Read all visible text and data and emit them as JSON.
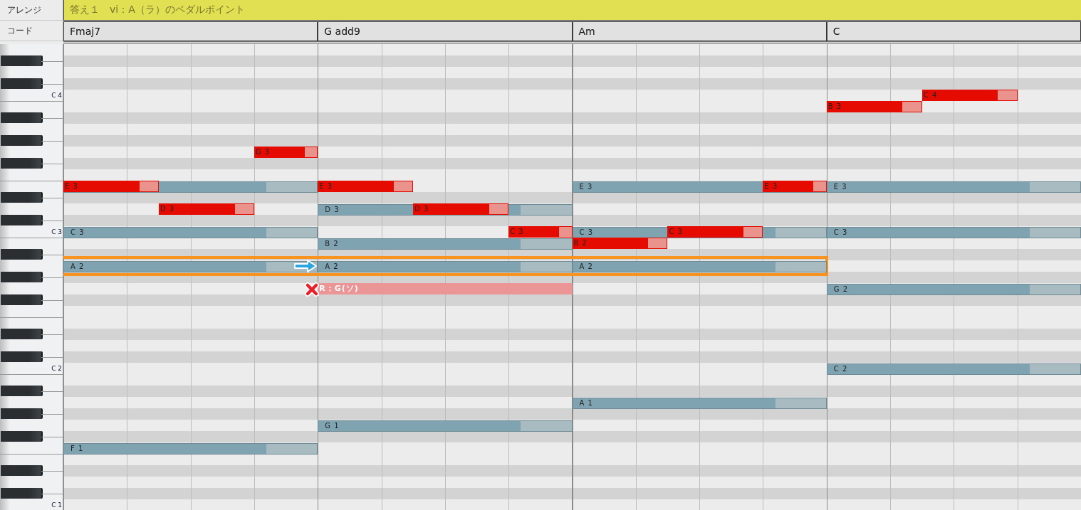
{
  "header": {
    "arrange_label": "アレンジ",
    "arrange_text": "答え１　vi：A（ラ）のペダルポイント",
    "chord_label": "コード",
    "chords": [
      "Fmaj7",
      "G add9",
      "Am",
      "C"
    ]
  },
  "keyboard_labels": [
    "C 4",
    "C 3",
    "C 2",
    "C 1"
  ],
  "notes": [
    {
      "kind": "chord"
    },
    {
      "kind": "chord",
      "label": "C 3"
    },
    {
      "kind": "chord",
      "label": "A 2"
    },
    {
      "kind": "chord",
      "label": "F 1"
    },
    {
      "kind": "chord",
      "label": "D 3"
    },
    {
      "kind": "chord",
      "label": "B 2"
    },
    {
      "kind": "chord",
      "label": "A 2"
    },
    {
      "kind": "chord",
      "label": "G 1"
    },
    {
      "kind": "chord",
      "label": "E 3"
    },
    {
      "kind": "chord",
      "label": "C 3"
    },
    {
      "kind": "chord",
      "label": "A 2"
    },
    {
      "kind": "chord",
      "label": "A 1"
    },
    {
      "kind": "chord",
      "label": "E 3"
    },
    {
      "kind": "chord",
      "label": "C 3"
    },
    {
      "kind": "chord",
      "label": "G 2"
    },
    {
      "kind": "chord",
      "label": "C 2"
    },
    {
      "kind": "melody",
      "label": "E 3"
    },
    {
      "kind": "melody",
      "label": "D 3"
    },
    {
      "kind": "melody",
      "label": "G 3"
    },
    {
      "kind": "melody",
      "label": "E 3"
    },
    {
      "kind": "melody",
      "label": "D 3"
    },
    {
      "kind": "melody",
      "label": "C 3"
    },
    {
      "kind": "melody",
      "label": "B 2"
    },
    {
      "kind": "melody",
      "label": "C 3"
    },
    {
      "kind": "melody",
      "label": "E 3"
    },
    {
      "kind": "melody",
      "label": "B 3"
    },
    {
      "kind": "melody",
      "label": "C 4"
    },
    {
      "kind": "rejected",
      "label": "R：G(ソ)"
    }
  ]
}
